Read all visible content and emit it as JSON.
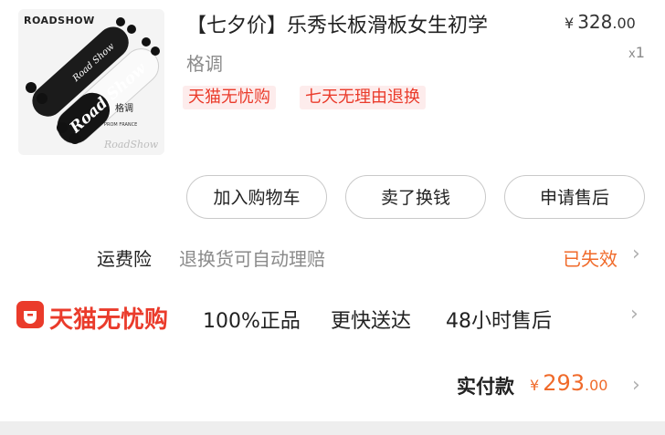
{
  "product": {
    "brand_logo": "ROADSHOW",
    "title": "【七夕价】乐秀长板滑板女生初学",
    "variant": "格调",
    "price": {
      "currency": "¥",
      "integer": "328",
      "decimal": ".00"
    },
    "quantity": {
      "prefix": "x",
      "value": "1"
    },
    "tags": [
      "天猫无忧购",
      "七天无理由退换"
    ],
    "image_texts": [
      "Road Show",
      "Road Show",
      "格调",
      "PROM FRANCE",
      "RoadShow"
    ]
  },
  "actions": [
    "加入购物车",
    "卖了换钱",
    "申请售后"
  ],
  "insurance": {
    "label": "运费险",
    "description": "退换货可自动理赔",
    "status": "已失效"
  },
  "tmall": {
    "name": "天猫无忧购",
    "features": [
      "100%正品",
      "更快送达",
      "48小时售后"
    ]
  },
  "payment": {
    "label": "实付款",
    "currency": "¥",
    "integer": "293",
    "decimal": ".00"
  },
  "colors": {
    "accent": "#f06a2a",
    "tmall_red": "#ea3b2b"
  },
  "icons": [
    "chevron-right-icon",
    "tmall-logo-icon"
  ]
}
